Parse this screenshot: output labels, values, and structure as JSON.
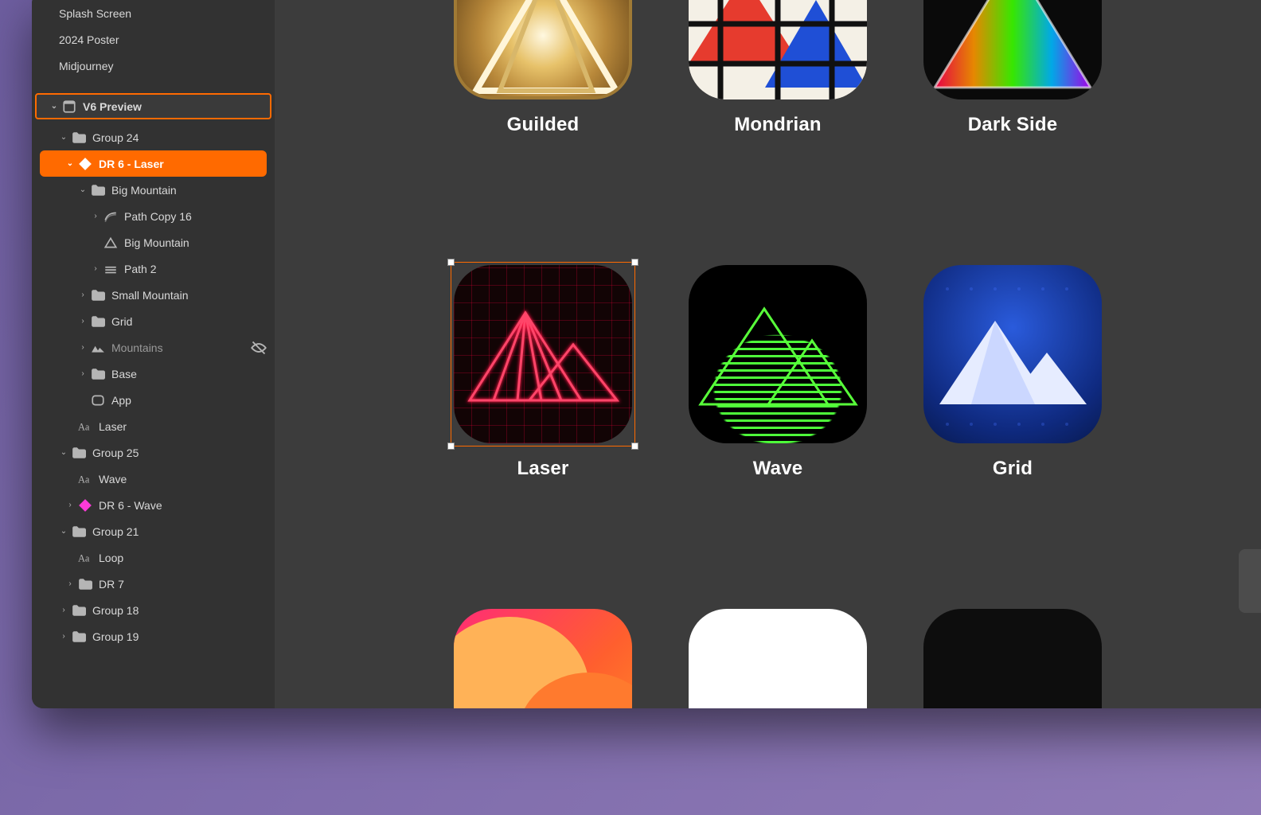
{
  "sidebar": {
    "top_items": [
      {
        "label": "Splash Screen"
      },
      {
        "label": "2024 Poster"
      },
      {
        "label": "Midjourney"
      }
    ],
    "section_header": "V6 Preview",
    "tree": {
      "group24": {
        "label": "Group 24"
      },
      "dr6_laser": {
        "label": "DR 6 - Laser"
      },
      "big_mountain_grp": {
        "label": "Big Mountain"
      },
      "path_copy_16": {
        "label": "Path Copy 16"
      },
      "big_mountain": {
        "label": "Big Mountain"
      },
      "path2": {
        "label": "Path 2"
      },
      "small_mountain": {
        "label": "Small Mountain"
      },
      "grid": {
        "label": "Grid"
      },
      "mountains": {
        "label": "Mountains"
      },
      "base": {
        "label": "Base"
      },
      "app": {
        "label": "App"
      },
      "laser_text": {
        "label": "Laser"
      },
      "group25": {
        "label": "Group 25"
      },
      "wave_text": {
        "label": "Wave"
      },
      "dr6_wave": {
        "label": "DR 6 - Wave"
      },
      "group21": {
        "label": "Group 21"
      },
      "loop_text": {
        "label": "Loop"
      },
      "dr7": {
        "label": "DR 7"
      },
      "group18": {
        "label": "Group 18"
      },
      "group19": {
        "label": "Group 19"
      }
    }
  },
  "canvas": {
    "row_top": [
      {
        "label": "Guilded"
      },
      {
        "label": "Mondrian"
      },
      {
        "label": "Dark Side"
      }
    ],
    "row_mid": [
      {
        "label": "Laser"
      },
      {
        "label": "Wave"
      },
      {
        "label": "Grid"
      }
    ]
  }
}
